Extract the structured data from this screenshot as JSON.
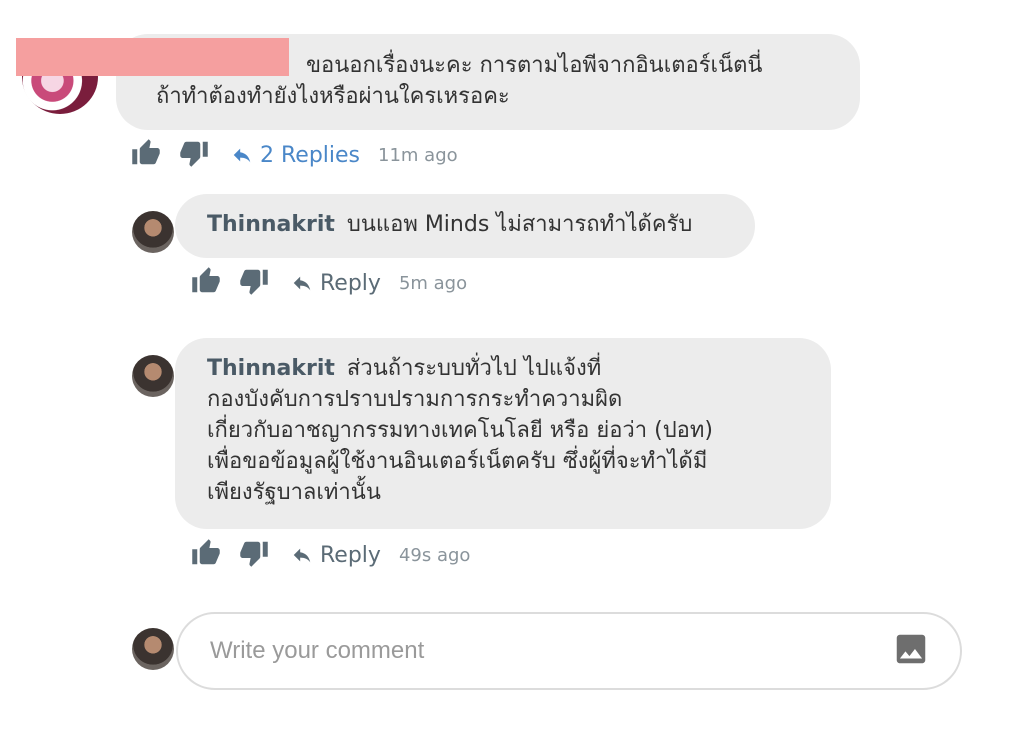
{
  "top_comment": {
    "text_line1": "ขอนอกเรื่องนะคะ การตามไอพีจากอินเตอร์เน็ตนี่",
    "text_line2": "ถ้าทำต้องทำยังไงหรือผ่านใครเหรอคะ",
    "replies_label": "2 Replies",
    "time": "11m ago"
  },
  "replies": [
    {
      "author": "Thinnakrit",
      "text": "บนแอพ Minds ไม่สามารถทำได้ครับ",
      "reply_label": "Reply",
      "time": "5m ago"
    },
    {
      "author": "Thinnakrit",
      "text_line1": "ส่วนถ้าระบบทั่วไป ไปแจ้งที่",
      "text_line2": "กองบังคับการปราบปรามการกระทำความผิด",
      "text_line3": "เกี่ยวกับอาชญากรรมทางเทคโนโลยี หรือ ย่อว่า (ปอท)",
      "text_line4": "เพื่อขอข้อมูลผู้ใช้งานอินเตอร์เน็ตครับ ซึ่งผู้ที่จะทำได้มี",
      "text_line5": "เพียงรัฐบาลเท่านั้น",
      "reply_label": "Reply",
      "time": "49s ago"
    }
  ],
  "composer": {
    "placeholder": "Write your comment"
  },
  "icons": {
    "like": "thumbs-up-icon",
    "dislike": "thumbs-down-icon",
    "reply": "reply-arrow-icon",
    "image": "image-icon"
  },
  "colors": {
    "bubble": "#ececec",
    "link": "#4a87c8",
    "icon": "#5b6b76",
    "redaction": "#f59f9f"
  }
}
